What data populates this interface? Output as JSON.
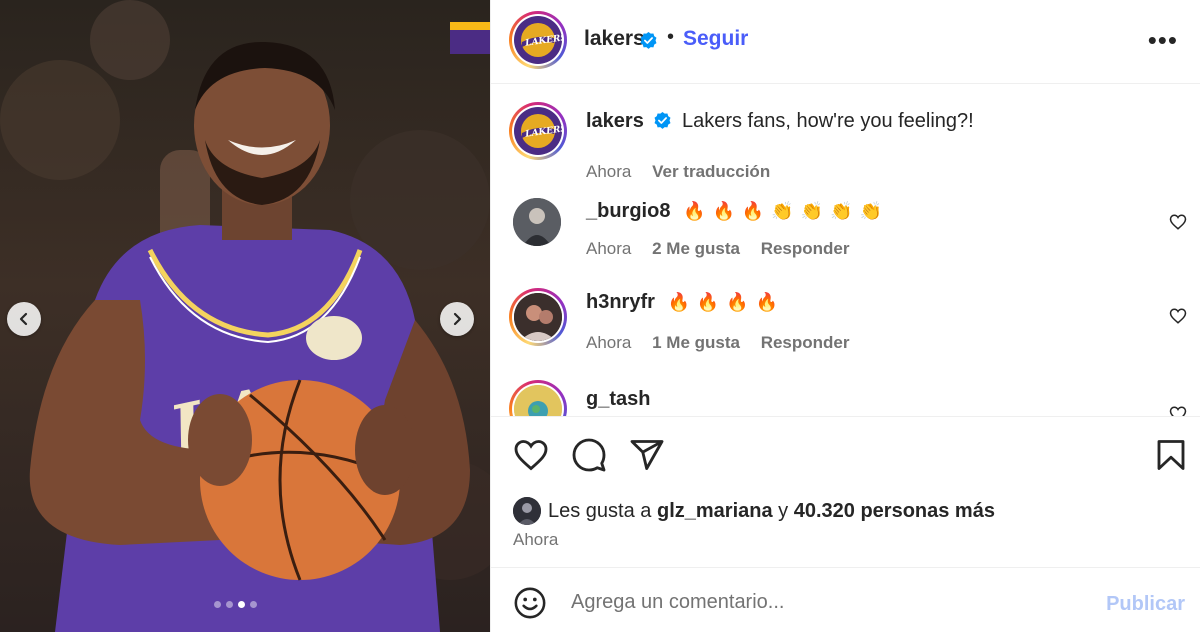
{
  "post": {
    "carousel": {
      "slide_count": 4,
      "active_index": 2
    }
  },
  "header": {
    "username": "lakers",
    "bullet": "•",
    "follow_label": "Seguir",
    "more_label": "•••"
  },
  "caption": {
    "username": "lakers",
    "text": "Lakers fans, how're you feeling?!",
    "time": "Ahora",
    "translate_label": "Ver traducción"
  },
  "comments": [
    {
      "username": "_burgio8",
      "emojis": [
        "🔥",
        "🔥",
        "🔥",
        "👏",
        "👏",
        "👏",
        "👏"
      ],
      "time": "Ahora",
      "likes": "2 Me gusta",
      "reply_label": "Responder"
    },
    {
      "username": "h3nryfr",
      "emojis": [
        "🔥",
        "🔥",
        "🔥",
        "🔥"
      ],
      "time": "Ahora",
      "likes": "1 Me gusta",
      "reply_label": "Responder"
    },
    {
      "username": "g_tash"
    }
  ],
  "likes": {
    "prefix": "Les gusta a",
    "user": "glz_mariana",
    "joiner": "y",
    "others": "40.320 personas más"
  },
  "post_time": "Ahora",
  "composer": {
    "placeholder": "Agrega un comentario...",
    "publish_label": "Publicar"
  },
  "colors": {
    "link_blue": "#4a5df9",
    "publish_disabled": "#b2c7f7",
    "lakers_purple": "#4b2c84",
    "lakers_gold": "#f7b817",
    "muted_text": "#737373"
  }
}
